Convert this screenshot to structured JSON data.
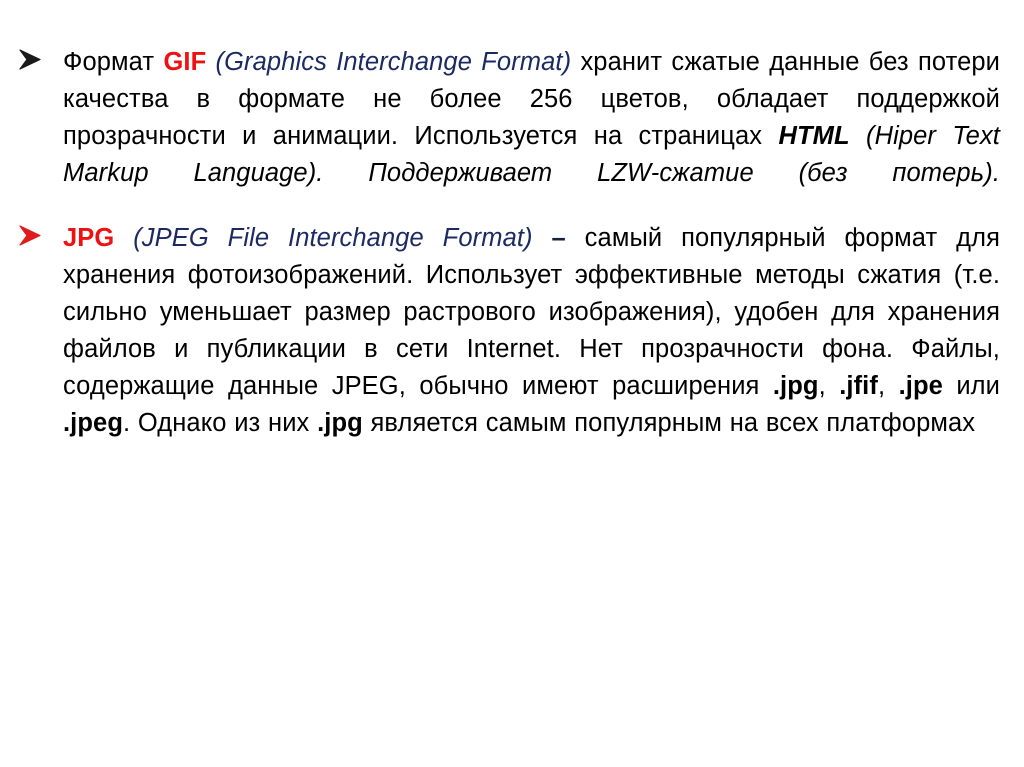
{
  "slide": {
    "background_color": "#ffffff",
    "text_color": "#000000",
    "accent_red": "#ee1111",
    "accent_blue": "#1b2a63",
    "bullets": [
      {
        "marker_icon": "arrowhead-bullet-icon",
        "marker_color": "#1a1a1a",
        "runs": [
          {
            "text": "Формат ",
            "style": "plain"
          },
          {
            "text": "GIF",
            "style": "red-bold"
          },
          {
            "text": " ",
            "style": "plain"
          },
          {
            "text": "(Graphics Interchange Format)",
            "style": "blue-italic"
          },
          {
            "text": " хранит сжатые данные без потери качества в формате не более 256 цветов, обладает поддержкой прозрачности и анимации. Используется на страницах ",
            "style": "plain"
          },
          {
            "text": "HTML",
            "style": "bold-italic"
          },
          {
            "text": " (Hiper Text Markup Language). Поддерживает LZW-сжатие (без потерь).",
            "style": "italic"
          }
        ]
      },
      {
        "marker_icon": "arrowhead-bullet-icon",
        "marker_color": "#e01b1b",
        "runs": [
          {
            "text": "JPG",
            "style": "red-bold"
          },
          {
            "text": " ",
            "style": "plain"
          },
          {
            "text": "(JPEG File Interchange Format)",
            "style": "blue-italic"
          },
          {
            "text": " ",
            "style": "plain"
          },
          {
            "text": "–",
            "style": "dark-bold"
          },
          {
            "text": " самый популярный формат для хранения фотоизображений. Использует эффективные методы сжатия (т.е. сильно уменьшает размер растрового изображения), удобен для хранения файлов и публикации в сети Internet. Нет прозрачности фона.  Файлы, содержащие данные JPEG, обычно имеют расширения ",
            "style": "plain"
          },
          {
            "text": ".jpg",
            "style": "bold"
          },
          {
            "text": ", ",
            "style": "plain"
          },
          {
            "text": ".jfif",
            "style": "bold"
          },
          {
            "text": ", ",
            "style": "plain"
          },
          {
            "text": ".jpe",
            "style": "bold"
          },
          {
            "text": " или ",
            "style": "plain"
          },
          {
            "text": ".jpeg",
            "style": "bold"
          },
          {
            "text": ". Однако из них ",
            "style": "plain"
          },
          {
            "text": ".jpg",
            "style": "bold"
          },
          {
            "text": " является самым популярным на всех платформах",
            "style": "plain"
          }
        ]
      }
    ]
  }
}
